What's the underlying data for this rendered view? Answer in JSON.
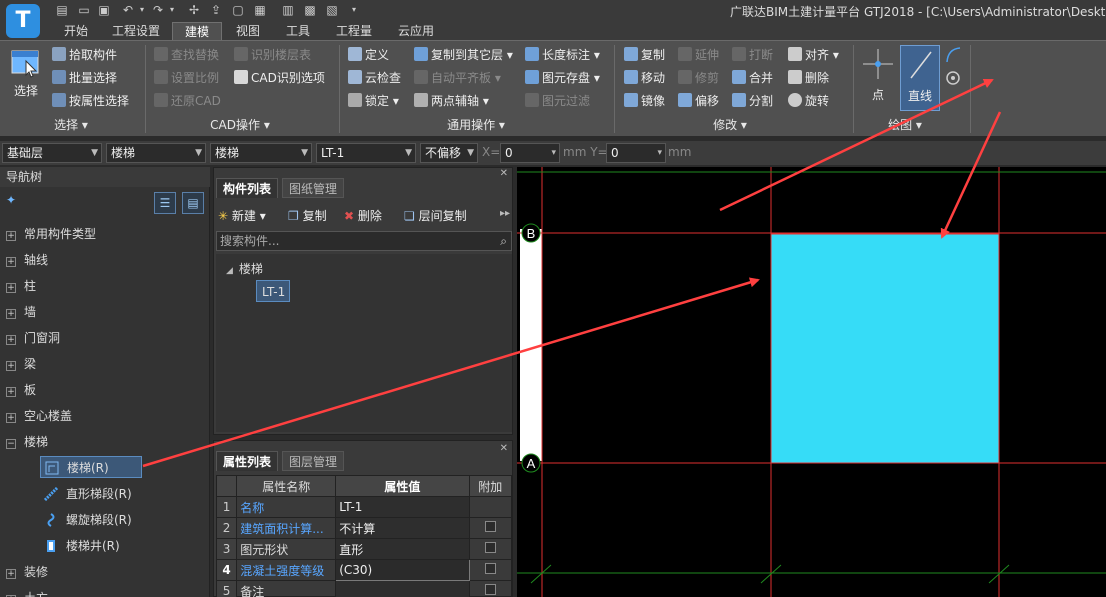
{
  "app": {
    "title": "广联达BIM土建计量平台 GTJ2018 - [C:\\Users\\Administrator\\Desktop",
    "logo_letter": "T"
  },
  "menu": {
    "tabs": [
      {
        "label": "开始"
      },
      {
        "label": "工程设置"
      },
      {
        "label": "建模",
        "active": true
      },
      {
        "label": "视图"
      },
      {
        "label": "工具"
      },
      {
        "label": "工程量"
      },
      {
        "label": "云应用"
      }
    ]
  },
  "ribbon": {
    "select": {
      "big_label": "选择",
      "items": [
        "拾取构件",
        "批量选择",
        "按属性选择"
      ],
      "group_label": "选择"
    },
    "cad": {
      "items": [
        "查找替换",
        "设置比例",
        "还原CAD",
        "识别楼层表",
        "CAD识别选项"
      ],
      "group_label": "CAD操作"
    },
    "general": {
      "items": [
        "定义",
        "云检查",
        "锁定",
        "复制到其它层",
        "自动平齐板",
        "两点辅轴",
        "长度标注",
        "图元存盘",
        "图元过滤"
      ],
      "group_label": "通用操作"
    },
    "modify": {
      "items": [
        "复制",
        "移动",
        "镜像",
        "延伸",
        "修剪",
        "偏移",
        "打断",
        "合并",
        "分割",
        "对齐",
        "删除",
        "旋转"
      ],
      "group_label": "修改"
    },
    "draw": {
      "point_label": "点",
      "line_label": "直线",
      "group_label": "绘图"
    }
  },
  "propbar": {
    "floor": "基础层",
    "category": "楼梯",
    "type": "楼梯",
    "component": "LT-1",
    "offset_mode": "不偏移",
    "x_label": "X=",
    "x_value": "0",
    "y_label": "mm Y=",
    "y_value": "0",
    "unit": "mm"
  },
  "nav": {
    "title": "导航树",
    "items": [
      {
        "label": "常用构件类型",
        "expanded": false
      },
      {
        "label": "轴线",
        "expanded": false
      },
      {
        "label": "柱",
        "expanded": false
      },
      {
        "label": "墙",
        "expanded": false
      },
      {
        "label": "门窗洞",
        "expanded": false
      },
      {
        "label": "梁",
        "expanded": false
      },
      {
        "label": "板",
        "expanded": false
      },
      {
        "label": "空心楼盖",
        "expanded": false
      },
      {
        "label": "楼梯",
        "expanded": true
      }
    ],
    "stair_children": [
      "楼梯(R)",
      "直形梯段(R)",
      "螺旋梯段(R)",
      "楼梯井(R)"
    ],
    "after": [
      "装修",
      "土方"
    ]
  },
  "components": {
    "tabs": [
      "构件列表",
      "图纸管理"
    ],
    "toolbar": [
      "新建",
      "复制",
      "删除",
      "层间复制"
    ],
    "search_placeholder": "搜索构件...",
    "tree_root": "楼梯",
    "tree_child": "LT-1"
  },
  "attributes": {
    "tabs": [
      "属性列表",
      "图层管理"
    ],
    "headers": [
      "属性名称",
      "属性值",
      "附加"
    ],
    "rows": [
      {
        "num": "1",
        "name": "名称",
        "value": "LT-1",
        "blue": true,
        "check": false
      },
      {
        "num": "2",
        "name": "建筑面积计算...",
        "value": "不计算",
        "blue": true,
        "check": true
      },
      {
        "num": "3",
        "name": "图元形状",
        "value": "直形",
        "blue": false,
        "check": true
      },
      {
        "num": "4",
        "name": "混凝土强度等级",
        "value": "(C30)",
        "blue": true,
        "check": true
      },
      {
        "num": "5",
        "name": "备注",
        "value": "",
        "blue": false,
        "check": true
      }
    ]
  },
  "canvas": {
    "axis_labels": [
      "B",
      "A"
    ],
    "fill_color": "#36dcf7",
    "grid_color_red": "#e03030",
    "grid_color_green": "#1f8a1f",
    "arrow_color": "#ff4040"
  }
}
